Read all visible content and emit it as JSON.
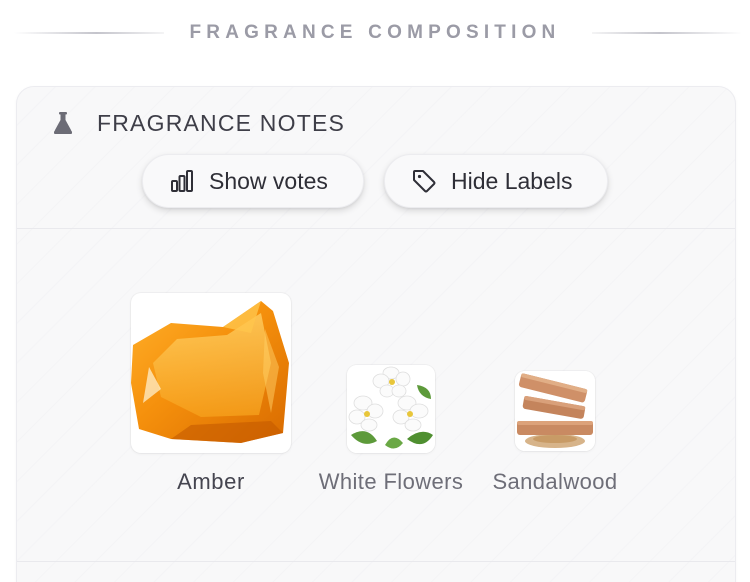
{
  "section": {
    "title": "FRAGRANCE COMPOSITION"
  },
  "notes_card": {
    "title": "FRAGRANCE NOTES",
    "title_icon": "flask-icon",
    "buttons": {
      "votes": {
        "label": "Show votes",
        "icon": "bar-chart-icon"
      },
      "labels": {
        "label": "Hide Labels",
        "icon": "tag-icon"
      }
    },
    "notes": [
      {
        "name": "Amber",
        "image": "amber-image"
      },
      {
        "name": "White Flowers",
        "image": "white-flowers-image"
      },
      {
        "name": "Sandalwood",
        "image": "sandalwood-image"
      }
    ]
  },
  "colors": {
    "header_text": "#9b9ba6",
    "title_text": "#3e3e48",
    "card_bg": "#f8f8f9",
    "amber": "#f08a10"
  }
}
